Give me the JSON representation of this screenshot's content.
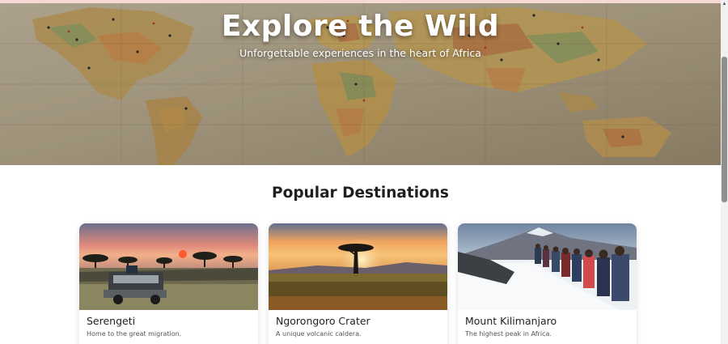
{
  "hero": {
    "title": "Explore the Wild",
    "subtitle": "Unforgettable experiences in the heart of Africa",
    "image_icon": "world-map-image"
  },
  "section": {
    "title": "Popular Destinations"
  },
  "destinations": [
    {
      "name": "Serengeti",
      "description": "Home to the great migration.",
      "image_icon": "safari-sunset-image"
    },
    {
      "name": "Ngorongoro Crater",
      "description": "A unique volcanic caldera.",
      "image_icon": "acacia-sunset-image"
    },
    {
      "name": "Mount Kilimanjaro",
      "description": "The highest peak in Africa.",
      "image_icon": "mountain-hikers-image"
    }
  ],
  "colors": {
    "accent_top": "#f6d9d4",
    "title_dark": "#1f1f1f",
    "text_muted": "#555555"
  }
}
